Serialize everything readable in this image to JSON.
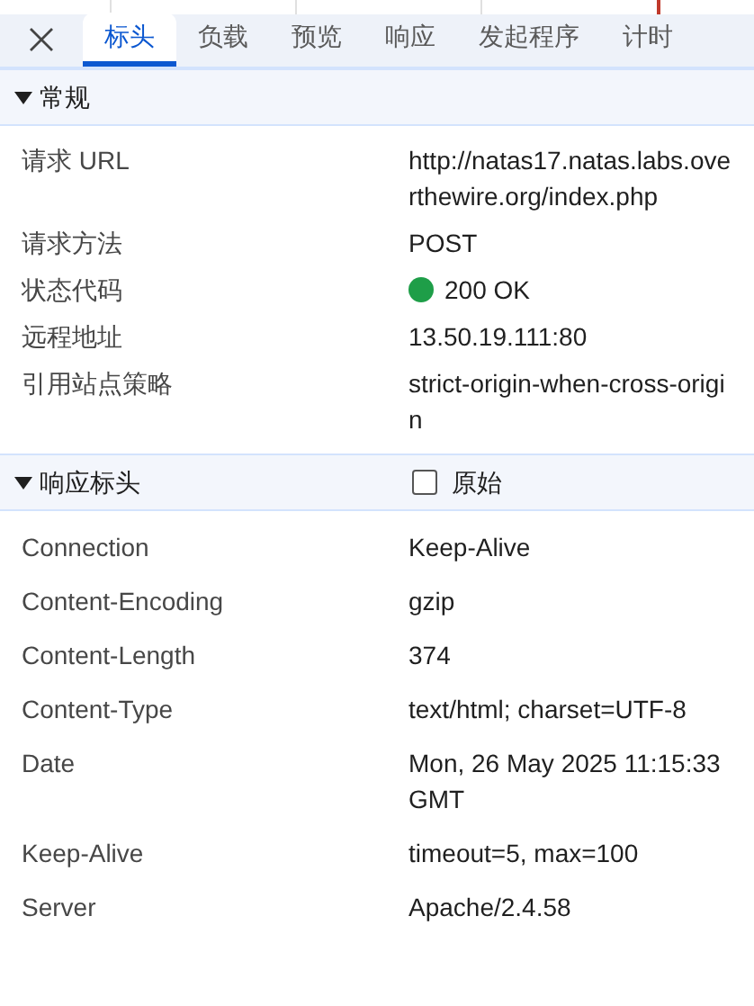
{
  "tabs": [
    {
      "label": "标头",
      "selected": true
    },
    {
      "label": "负载",
      "selected": false
    },
    {
      "label": "预览",
      "selected": false
    },
    {
      "label": "响应",
      "selected": false
    },
    {
      "label": "发起程序",
      "selected": false
    },
    {
      "label": "计时",
      "selected": false
    }
  ],
  "general": {
    "title": "常规",
    "expanded": true,
    "rows": [
      {
        "name": "请求 URL",
        "value": "http://natas17.natas.labs.overthewire.org/index.php"
      },
      {
        "name": "请求方法",
        "value": "POST"
      },
      {
        "name": "状态代码",
        "value": "200 OK",
        "color": "#1e9e48"
      },
      {
        "name": "远程地址",
        "value": "13.50.19.111:80"
      },
      {
        "name": "引用站点策略",
        "value": "strict-origin-when-cross-origin"
      }
    ]
  },
  "response_headers": {
    "title": "响应标头",
    "expanded": true,
    "raw": {
      "label": "原始",
      "checked": false
    },
    "rows": [
      {
        "name": "Connection",
        "value": "Keep-Alive"
      },
      {
        "name": "Content-Encoding",
        "value": "gzip"
      },
      {
        "name": "Content-Length",
        "value": "374"
      },
      {
        "name": "Content-Type",
        "value": "text/html; charset=UTF-8"
      },
      {
        "name": "Date",
        "value": "Mon, 26 May 2025 11:15:33 GMT"
      },
      {
        "name": "Keep-Alive",
        "value": "timeout=5, max=100"
      },
      {
        "name": "Server",
        "value": "Apache/2.4.58"
      }
    ]
  }
}
